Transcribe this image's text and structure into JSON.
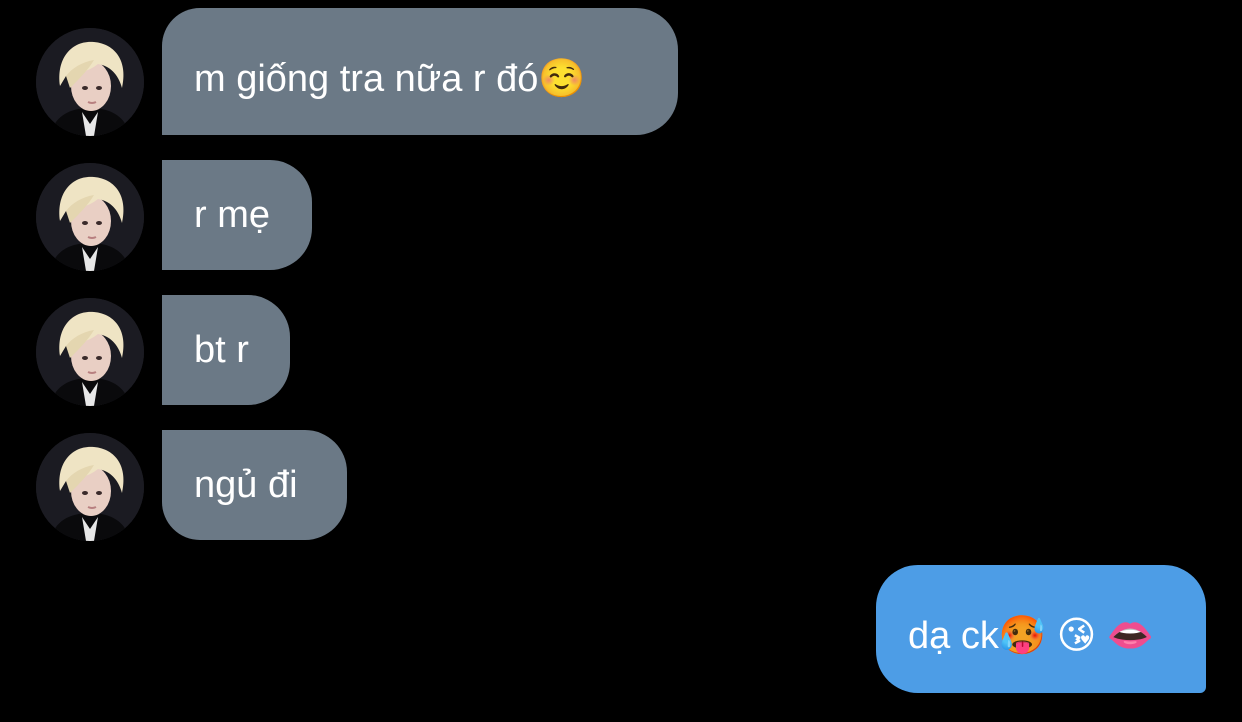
{
  "colors": {
    "background": "#000000",
    "incoming_bubble": "#6b7986",
    "outgoing_bubble": "#4d9de6",
    "text": "#ffffff"
  },
  "messages": [
    {
      "direction": "incoming",
      "text": "m giống tra nữa r đó☺️",
      "avatar": "contact-avatar"
    },
    {
      "direction": "incoming",
      "text": "r mẹ",
      "avatar": "contact-avatar"
    },
    {
      "direction": "incoming",
      "text": "bt r",
      "avatar": "contact-avatar"
    },
    {
      "direction": "incoming",
      "text": "ngủ đi",
      "avatar": "contact-avatar"
    },
    {
      "direction": "outgoing",
      "text": "dạ ck🥵 😘 👄"
    }
  ]
}
